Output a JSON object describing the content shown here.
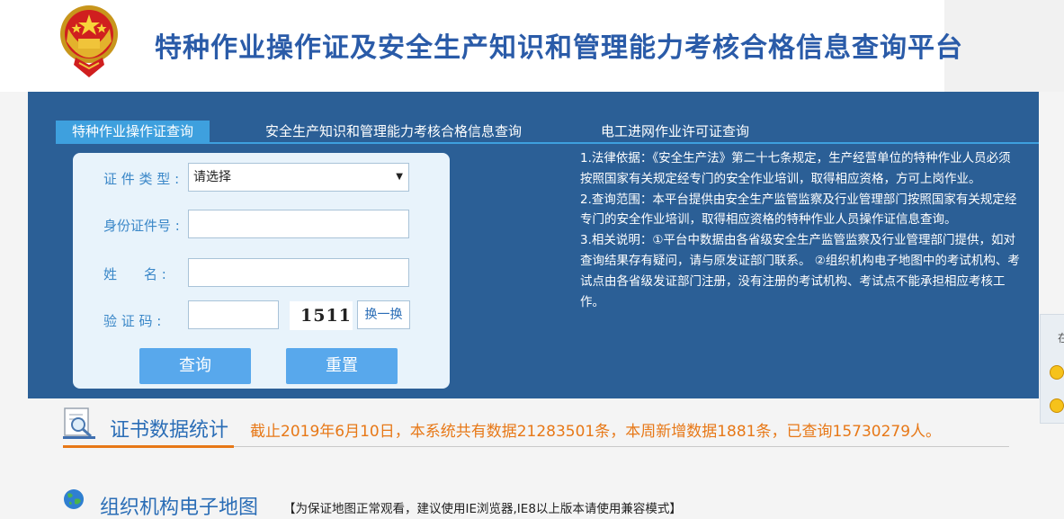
{
  "header": {
    "title": "特种作业操作证及安全生产知识和管理能力考核合格信息查询平台"
  },
  "tabs": [
    {
      "label": "特种作业操作证查询",
      "active": true
    },
    {
      "label": "安全生产知识和管理能力考核合格信息查询",
      "active": false
    },
    {
      "label": "电工进网作业许可证查询",
      "active": false
    }
  ],
  "form": {
    "cert_type_label": "证 件 类 型 :",
    "cert_type_value": "请选择",
    "id_label": "身份证件号 :",
    "id_value": "",
    "name_label": "姓　　名 :",
    "name_value": "",
    "captcha_label": "验 证 码 :",
    "captcha_value": "",
    "captcha_image": "1511",
    "swap_label": "换一换",
    "query_label": "查询",
    "reset_label": "重置"
  },
  "notes": [
    "1.法律依据：《安全生产法》第二十七条规定，生产经营单位的特种作业人员必须按照国家有关规定经专门的安全作业培训，取得相应资格，方可上岗作业。",
    "2.查询范围：本平台提供由安全生产监管监察及行业管理部门按照国家有关规定经专门的安全作业培训，取得相应资格的特种作业人员操作证信息查询。",
    "3.相关说明：①平台中数据由各省级安全生产监管监察及行业管理部门提供，如对查询结果存有疑问，请与原发证部门联系。 ②组织机构电子地图中的考试机构、考试点由各省级发证部门注册，没有注册的考试机构、考试点不能承担相应考核工作。"
  ],
  "stats": {
    "title": "证书数据统计",
    "text": "截止2019年6月10日，本系统共有数据21283501条，本周新增数据1881条，已查询15730279人。"
  },
  "map": {
    "title": "组织机构电子地图",
    "note": "【为保证地图正常观看，建议使用IE浏览器,IE8以上版本请使用兼容模式】"
  },
  "side": {
    "char": "在"
  },
  "colors": {
    "band": "#2b5f96",
    "tab_active": "#3ea0de",
    "button": "#58a8ec",
    "accent_orange": "#e77817",
    "title_blue": "#2a5ba8"
  }
}
